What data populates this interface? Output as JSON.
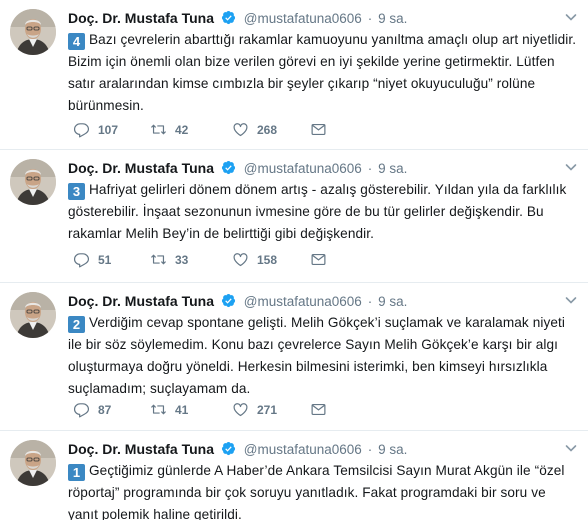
{
  "tweets": [
    {
      "name": "Doç. Dr. Mustafa Tuna",
      "handle": "@mustafatuna0606",
      "dot": "·",
      "time": "9 sa.",
      "number": "4",
      "text": "Bazı çevrelerin abarttığı rakamlar kamuoyunu yanıltma amaçlı olup art niyetlidir. Bizim için önemli olan bize verilen görevi en iyi şekilde yerine getirmektir. Lütfen satır aralarından kimse cımbızla bir şeyler çıkarıp “niyet okuyuculuğu” rolüne bürünmesin.",
      "replies": "107",
      "retweets": "42",
      "likes": "268"
    },
    {
      "name": "Doç. Dr. Mustafa Tuna",
      "handle": "@mustafatuna0606",
      "dot": "·",
      "time": "9 sa.",
      "number": "3",
      "text": "Hafriyat gelirleri dönem dönem artış - azalış gösterebilir. Yıldan yıla da farklılık gösterebilir. İnşaat sezonunun ivmesine göre de bu tür gelirler değişkendir. Bu rakamlar Melih Bey’in de belirttiği gibi değişkendir.",
      "replies": "51",
      "retweets": "33",
      "likes": "158"
    },
    {
      "name": "Doç. Dr. Mustafa Tuna",
      "handle": "@mustafatuna0606",
      "dot": "·",
      "time": "9 sa.",
      "number": "2",
      "text": "Verdiğim cevap spontane gelişti. Melih Gökçek’i suçlamak ve karalamak niyeti ile bir söz söylemedim. Konu bazı çevrelerce Sayın Melih Gökçek’e karşı bir algı oluşturmaya doğru yöneldi. Herkesin bilmesini isterimki, ben kimseyi hırsızlıkla suçlamadım; suçlayamam da.",
      "replies": "87",
      "retweets": "41",
      "likes": "271"
    },
    {
      "name": "Doç. Dr. Mustafa Tuna",
      "handle": "@mustafatuna0606",
      "dot": "·",
      "time": "9 sa.",
      "number": "1",
      "text": "Geçtiğimiz günlerde A Haber’de Ankara Temsilcisi Sayın Murat Akgün ile “özel röportaj” programında bir çok soruyu yanıtladık. Fakat programdaki bir soru ve yanıt polemik haline getirildi."
    }
  ],
  "colors": {
    "verified": "#1da1f2",
    "keycap": "#3b88c3",
    "secondary_text": "#657786",
    "divider": "#e6ecf0"
  },
  "icons": [
    "verified-badge-icon",
    "chevron-down-icon",
    "reply-icon",
    "retweet-icon",
    "like-icon",
    "direct-message-icon"
  ]
}
